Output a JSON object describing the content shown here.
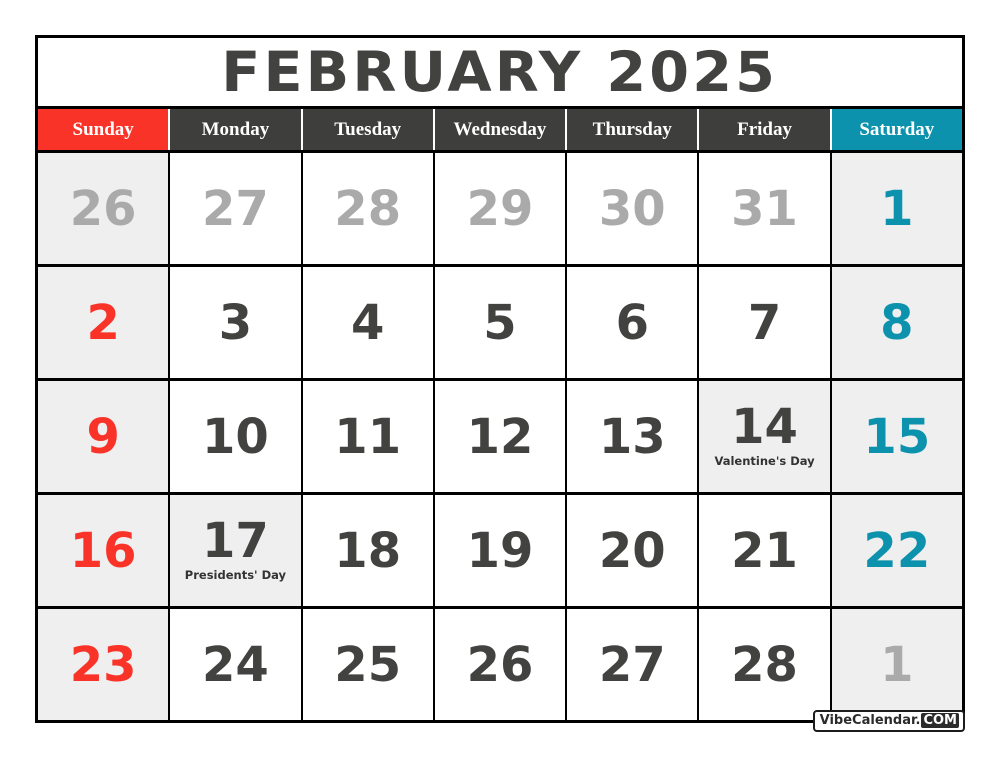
{
  "title": "FEBRUARY 2025",
  "month": "February",
  "year": "2025",
  "colors": {
    "sunday_accent": "#FA3328",
    "saturday_accent": "#0C92AC",
    "header_dark": "#3E3E3C",
    "number_dark": "#424240",
    "muted_number": "#AAAAAA",
    "weekend_cell_bg": "#EFEFEF",
    "holiday_cell_bg": "#EFEFEF",
    "border": "#000000",
    "cell_bg": "#FFFFFF"
  },
  "weekdays": [
    {
      "label": "Sunday",
      "kind": "sunday"
    },
    {
      "label": "Monday",
      "kind": "weekday"
    },
    {
      "label": "Tuesday",
      "kind": "weekday"
    },
    {
      "label": "Wednesday",
      "kind": "weekday"
    },
    {
      "label": "Thursday",
      "kind": "weekday"
    },
    {
      "label": "Friday",
      "kind": "weekday"
    },
    {
      "label": "Saturday",
      "kind": "saturday"
    }
  ],
  "weeks": [
    [
      {
        "num": "26",
        "state": "outside",
        "col": "sun",
        "label": ""
      },
      {
        "num": "27",
        "state": "outside",
        "col": "wd",
        "label": ""
      },
      {
        "num": "28",
        "state": "outside",
        "col": "wd",
        "label": ""
      },
      {
        "num": "29",
        "state": "outside",
        "col": "wd",
        "label": ""
      },
      {
        "num": "30",
        "state": "outside",
        "col": "wd",
        "label": ""
      },
      {
        "num": "31",
        "state": "outside",
        "col": "wd",
        "label": ""
      },
      {
        "num": "1",
        "state": "current",
        "col": "sat",
        "label": ""
      }
    ],
    [
      {
        "num": "2",
        "state": "current",
        "col": "sun",
        "label": ""
      },
      {
        "num": "3",
        "state": "current",
        "col": "wd",
        "label": ""
      },
      {
        "num": "4",
        "state": "current",
        "col": "wd",
        "label": ""
      },
      {
        "num": "5",
        "state": "current",
        "col": "wd",
        "label": ""
      },
      {
        "num": "6",
        "state": "current",
        "col": "wd",
        "label": ""
      },
      {
        "num": "7",
        "state": "current",
        "col": "wd",
        "label": ""
      },
      {
        "num": "8",
        "state": "current",
        "col": "sat",
        "label": ""
      }
    ],
    [
      {
        "num": "9",
        "state": "current",
        "col": "sun",
        "label": ""
      },
      {
        "num": "10",
        "state": "current",
        "col": "wd",
        "label": ""
      },
      {
        "num": "11",
        "state": "current",
        "col": "wd",
        "label": ""
      },
      {
        "num": "12",
        "state": "current",
        "col": "wd",
        "label": ""
      },
      {
        "num": "13",
        "state": "current",
        "col": "wd",
        "label": ""
      },
      {
        "num": "14",
        "state": "current",
        "col": "wd",
        "label": "Valentine's Day"
      },
      {
        "num": "15",
        "state": "current",
        "col": "sat",
        "label": ""
      }
    ],
    [
      {
        "num": "16",
        "state": "current",
        "col": "sun",
        "label": ""
      },
      {
        "num": "17",
        "state": "current",
        "col": "wd",
        "label": "Presidents' Day"
      },
      {
        "num": "18",
        "state": "current",
        "col": "wd",
        "label": ""
      },
      {
        "num": "19",
        "state": "current",
        "col": "wd",
        "label": ""
      },
      {
        "num": "20",
        "state": "current",
        "col": "wd",
        "label": ""
      },
      {
        "num": "21",
        "state": "current",
        "col": "wd",
        "label": ""
      },
      {
        "num": "22",
        "state": "current",
        "col": "sat",
        "label": ""
      }
    ],
    [
      {
        "num": "23",
        "state": "current",
        "col": "sun",
        "label": ""
      },
      {
        "num": "24",
        "state": "current",
        "col": "wd",
        "label": ""
      },
      {
        "num": "25",
        "state": "current",
        "col": "wd",
        "label": ""
      },
      {
        "num": "26",
        "state": "current",
        "col": "wd",
        "label": ""
      },
      {
        "num": "27",
        "state": "current",
        "col": "wd",
        "label": ""
      },
      {
        "num": "28",
        "state": "current",
        "col": "wd",
        "label": ""
      },
      {
        "num": "1",
        "state": "outside",
        "col": "sat",
        "label": ""
      }
    ]
  ],
  "holidays": [
    {
      "date": "14",
      "name": "Valentine's Day"
    },
    {
      "date": "17",
      "name": "Presidents' Day"
    }
  ],
  "watermark": {
    "name": "VibeCalendar.",
    "tld": "COM"
  }
}
